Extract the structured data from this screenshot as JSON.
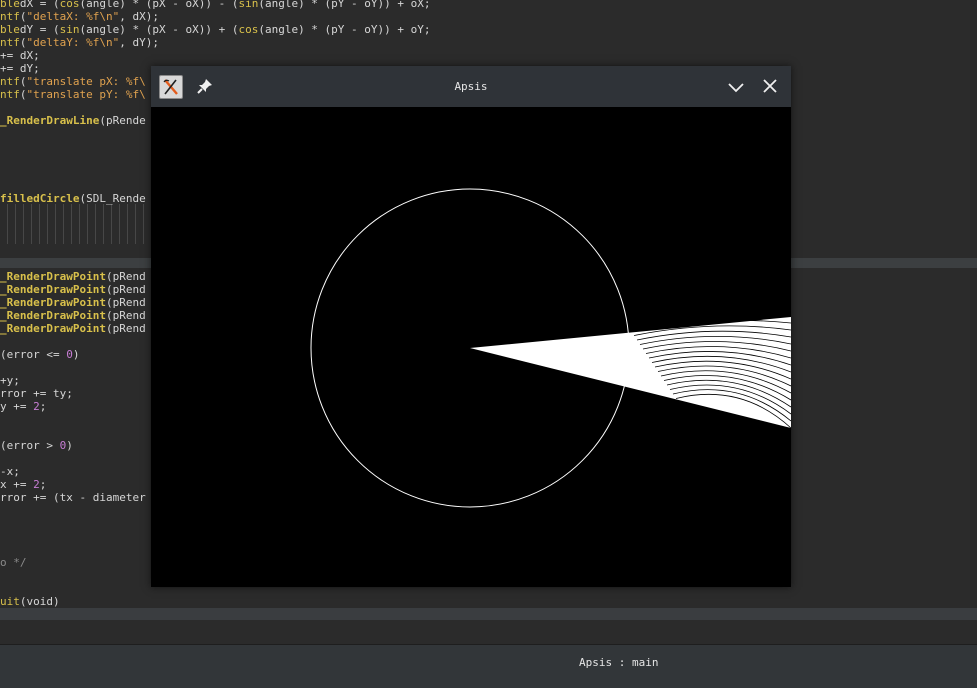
{
  "editor": {
    "lines": [
      {
        "parts": [
          [
            "kw",
            "ble"
          ],
          [
            "",
            "dX = ("
          ],
          [
            "kw",
            "cos"
          ],
          [
            "",
            "(angle) * (pX - oX)) - ("
          ],
          [
            "kw",
            "sin"
          ],
          [
            "",
            "(angle) * (pY - oY)) + oX;"
          ]
        ]
      },
      {
        "parts": [
          [
            "kw",
            "ntf"
          ],
          [
            "",
            "("
          ],
          [
            "str",
            "\"deltaX: %f\\n\""
          ],
          [
            "",
            ", dX);"
          ]
        ]
      },
      {
        "parts": [
          [
            "kw",
            "ble"
          ],
          [
            "",
            "dY = ("
          ],
          [
            "kw",
            "sin"
          ],
          [
            "",
            "(angle) * (pX - oX)) + ("
          ],
          [
            "kw",
            "cos"
          ],
          [
            "",
            "(angle) * (pY - oY)) + oY;"
          ]
        ]
      },
      {
        "parts": [
          [
            "kw",
            "ntf"
          ],
          [
            "",
            "("
          ],
          [
            "str",
            "\"deltaY: %f\\n\""
          ],
          [
            "",
            ", dY);"
          ]
        ]
      },
      {
        "parts": [
          [
            "",
            "+= dX;"
          ]
        ]
      },
      {
        "parts": [
          [
            "",
            "+= dY;"
          ]
        ]
      },
      {
        "parts": [
          [
            "kw",
            "ntf"
          ],
          [
            "",
            "("
          ],
          [
            "str",
            "\"translate pX: %f\\"
          ]
        ]
      },
      {
        "parts": [
          [
            "kw",
            "ntf"
          ],
          [
            "",
            "("
          ],
          [
            "str",
            "\"translate pY: %f\\"
          ]
        ]
      },
      {
        "parts": []
      },
      {
        "parts": [
          [
            "fn",
            "_RenderDrawLine"
          ],
          [
            "",
            "(pRende"
          ]
        ]
      },
      {
        "parts": []
      },
      {
        "parts": []
      },
      {
        "parts": []
      },
      {
        "parts": []
      },
      {
        "parts": []
      },
      {
        "parts": [
          [
            "fn",
            "filledCircle"
          ],
          [
            "",
            "(SDL_Rende"
          ]
        ]
      },
      {
        "parts": []
      },
      {
        "parts": []
      },
      {
        "parts": []
      },
      {
        "parts": []
      },
      {
        "parts": []
      },
      {
        "parts": [
          [
            "fn",
            "_RenderDrawPoint"
          ],
          [
            "",
            "(pRend"
          ]
        ]
      },
      {
        "parts": [
          [
            "fn",
            "_RenderDrawPoint"
          ],
          [
            "",
            "(pRend"
          ]
        ]
      },
      {
        "parts": [
          [
            "fn",
            "_RenderDrawPoint"
          ],
          [
            "",
            "(pRend"
          ]
        ]
      },
      {
        "parts": [
          [
            "fn",
            "_RenderDrawPoint"
          ],
          [
            "",
            "(pRend"
          ]
        ]
      },
      {
        "parts": [
          [
            "fn",
            "_RenderDrawPoint"
          ],
          [
            "",
            "(pRend"
          ]
        ]
      },
      {
        "parts": []
      },
      {
        "parts": [
          [
            "",
            "(error <= "
          ],
          [
            "num",
            "0"
          ],
          [
            "",
            ")"
          ]
        ]
      },
      {
        "parts": []
      },
      {
        "parts": [
          [
            "",
            "+y;"
          ]
        ]
      },
      {
        "parts": [
          [
            "",
            "rror += ty;"
          ]
        ]
      },
      {
        "parts": [
          [
            "",
            "y += "
          ],
          [
            "num",
            "2"
          ],
          [
            "",
            ";"
          ]
        ]
      },
      {
        "parts": []
      },
      {
        "parts": []
      },
      {
        "parts": [
          [
            "",
            "(error > "
          ],
          [
            "num",
            "0"
          ],
          [
            "",
            ")"
          ]
        ]
      },
      {
        "parts": []
      },
      {
        "parts": [
          [
            "",
            "-x;"
          ]
        ]
      },
      {
        "parts": [
          [
            "",
            "x += "
          ],
          [
            "num",
            "2"
          ],
          [
            "",
            ";"
          ]
        ]
      },
      {
        "parts": [
          [
            "",
            "rror += (tx - diameter"
          ]
        ]
      },
      {
        "parts": []
      },
      {
        "parts": []
      },
      {
        "parts": []
      },
      {
        "parts": []
      },
      {
        "parts": [
          [
            "cmt",
            "o */"
          ]
        ]
      },
      {
        "parts": []
      },
      {
        "parts": []
      },
      {
        "parts": [
          [
            "kw",
            "uit"
          ],
          [
            "",
            "(void)"
          ]
        ]
      }
    ]
  },
  "window": {
    "title": "Apsis",
    "icons": {
      "app": "app-logo-icon",
      "pin": "pin-icon",
      "minimize": "chevron-down-icon",
      "close": "close-icon"
    },
    "colors": {
      "titlebar": "#2f3338",
      "canvas": "#000000",
      "drawing": "#ffffff"
    }
  },
  "statusbar": {
    "text": "Apsis : main"
  },
  "colors": {
    "editor_bg": "#2b2b2b",
    "keyword": "#d8c04b",
    "string": "#e0a24f",
    "number": "#c77dd4"
  }
}
